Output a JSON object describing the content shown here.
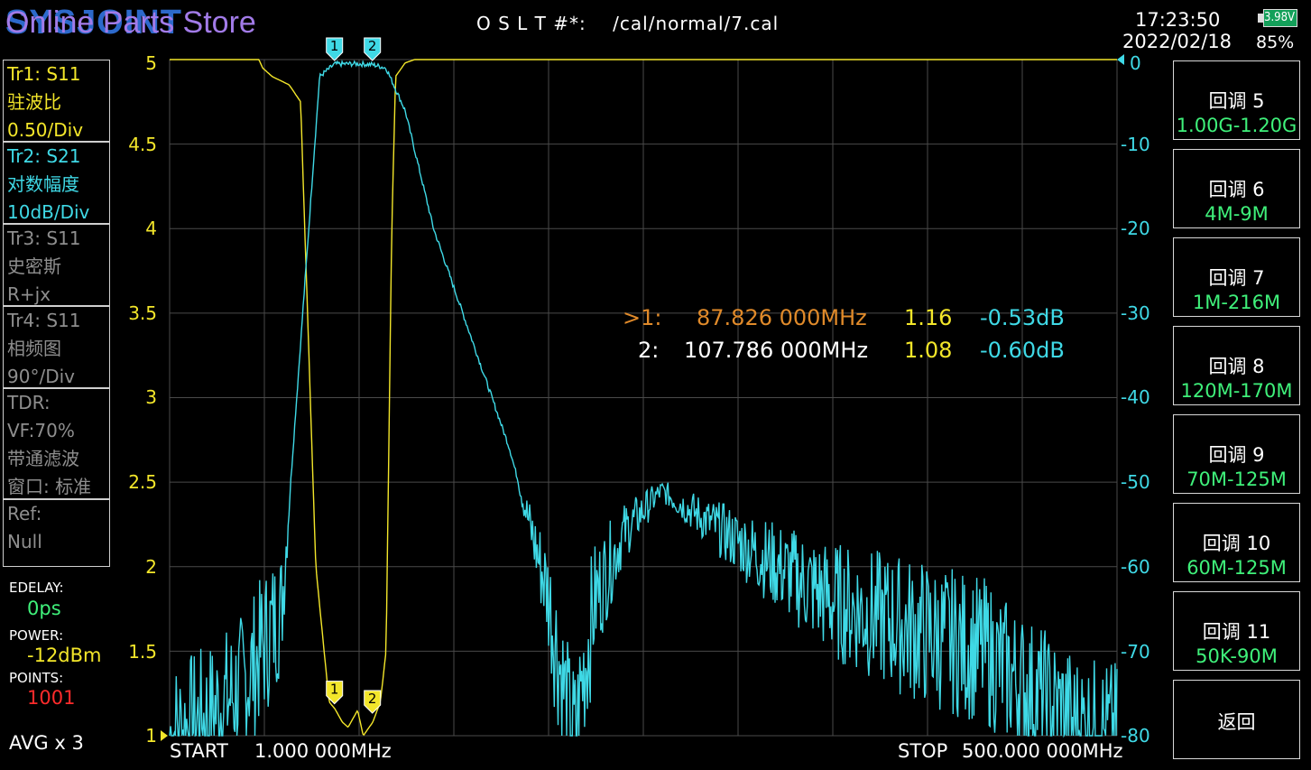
{
  "header": {
    "brand": "SYSJOINT",
    "store_overlay": "Online Parts Store",
    "cal_label": "O S L T #*:",
    "cal_file": "/cal/normal/7.cal",
    "time": "17:23:50",
    "date": "2022/02/18",
    "battery_voltage": "3.98V",
    "battery_percent": "85%"
  },
  "traces": [
    {
      "lines": [
        "Tr1:   S11",
        "驻波比",
        "0.50/Div"
      ],
      "color": "#f3e62a"
    },
    {
      "lines": [
        "Tr2:   S21",
        "对数幅度",
        "10dB/Div"
      ],
      "color": "#3fd9e6"
    },
    {
      "lines": [
        "Tr3:   S11",
        "史密斯",
        "R+jx"
      ],
      "color": "#8e8e8e"
    },
    {
      "lines": [
        "Tr4:   S11",
        "相频图",
        "90°/Div"
      ],
      "color": "#8e8e8e"
    },
    {
      "lines": [
        "TDR:",
        "VF:70%",
        "带通滤波",
        "窗口: 标准"
      ],
      "color": "#8e8e8e"
    },
    {
      "lines": [
        "Ref:",
        "Null"
      ],
      "color": "#8e8e8e"
    }
  ],
  "settings": {
    "edelay_label": "EDELAY:",
    "edelay_value": "0ps",
    "power_label": "POWER:",
    "power_value": "-12dBm",
    "points_label": "POINTS:",
    "points_value": "1001",
    "avg": "AVG x 3"
  },
  "sweep": {
    "start_label": "START",
    "start_value": "1.000 000MHz",
    "stop_label": "STOP",
    "stop_value": "500.000 000MHz"
  },
  "markers": [
    {
      "prefix": ">1:",
      "freq": "87.826 000MHz",
      "swr": "1.16",
      "db": "-0.53dB",
      "active": true
    },
    {
      "prefix": "2:",
      "freq": "107.786 000MHz",
      "swr": "1.08",
      "db": "-0.60dB",
      "active": false
    }
  ],
  "menu": [
    {
      "title": "回调 5",
      "sub": "1.00G-1.20G"
    },
    {
      "title": "回调 6",
      "sub": "4M-9M"
    },
    {
      "title": "回调 7",
      "sub": "1M-216M"
    },
    {
      "title": "回调 8",
      "sub": "120M-170M"
    },
    {
      "title": "回调 9",
      "sub": "70M-125M"
    },
    {
      "title": "回调 10",
      "sub": "60M-125M"
    },
    {
      "title": "回调 11",
      "sub": "50K-90M"
    },
    {
      "title": "返回",
      "sub": ""
    }
  ],
  "chart_data": {
    "type": "line",
    "xlabel": "",
    "ylabel": "",
    "x_range_mhz": [
      1,
      500
    ],
    "y_left": {
      "unit": "SWR",
      "ticks": [
        "5",
        "4.5",
        "4",
        "3.5",
        "3",
        "2.5",
        "2",
        "1.5",
        "1"
      ],
      "ylim": [
        1,
        5
      ]
    },
    "y_right": {
      "unit": "dB",
      "ticks": [
        "0",
        "-10",
        "-20",
        "-30",
        "-40",
        "-50",
        "-60",
        "-70",
        "-80"
      ],
      "ylim": [
        -80,
        0
      ]
    },
    "grid": true,
    "series": [
      {
        "name": "Tr1: S11",
        "axis": "left",
        "color": "#f3e62a",
        "x": [
          1,
          30,
          48,
          50,
          55,
          64,
          70,
          78,
          85,
          88,
          92,
          95,
          100,
          103,
          108,
          112,
          115,
          118,
          120,
          125,
          130,
          140,
          200,
          300,
          400,
          500
        ],
        "y": [
          5,
          5,
          5,
          4.95,
          4.9,
          4.85,
          4.75,
          2.0,
          1.2,
          1.16,
          1.08,
          1.05,
          1.15,
          1.0,
          1.08,
          1.2,
          1.5,
          4.0,
          4.9,
          4.98,
          5,
          5,
          5,
          5,
          5,
          5
        ]
      },
      {
        "name": "Tr2: S21",
        "axis": "right",
        "color": "#3fd9e6",
        "x": [
          1,
          20,
          40,
          60,
          80,
          88,
          100,
          108,
          115,
          125,
          140,
          160,
          180,
          200,
          212,
          215,
          218,
          225,
          240,
          260,
          300,
          350,
          400,
          430,
          450,
          480,
          500
        ],
        "y": [
          -80,
          -78,
          -74,
          -65,
          -2,
          -0.53,
          -0.5,
          -0.6,
          -1,
          -6,
          -20,
          -33,
          -46,
          -63,
          -79,
          -80,
          -74,
          -64,
          -56,
          -51,
          -57,
          -64,
          -68,
          -70,
          -74,
          -79,
          -80
        ]
      }
    ],
    "marker_points": [
      {
        "label": "1",
        "x": 87.826
      },
      {
        "label": "2",
        "x": 107.786
      }
    ]
  }
}
